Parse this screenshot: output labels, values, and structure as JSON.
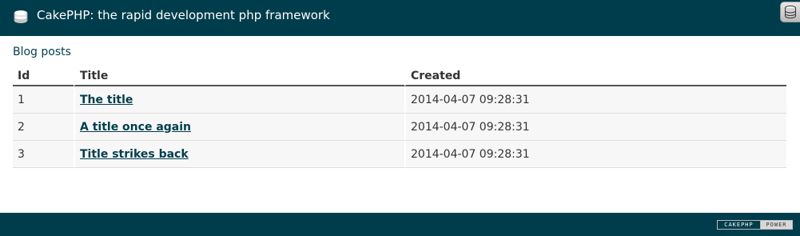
{
  "header": {
    "title": "CakePHP: the rapid development php framework",
    "logo_icon": "cakephp-logo-icon",
    "debug_icon": "database-icon",
    "background_color": "#003d4c"
  },
  "page": {
    "heading": "Blog posts"
  },
  "table": {
    "columns": [
      "Id",
      "Title",
      "Created"
    ],
    "rows": [
      {
        "id": "1",
        "title": "The title",
        "created": "2014-04-07 09:28:31"
      },
      {
        "id": "2",
        "title": "A title once again",
        "created": "2014-04-07 09:28:31"
      },
      {
        "id": "3",
        "title": "Title strikes back",
        "created": "2014-04-07 09:28:31"
      }
    ]
  },
  "footer": {
    "badge_left": "CAKEPHP",
    "badge_right": "POWER",
    "background_color": "#003d4c"
  }
}
